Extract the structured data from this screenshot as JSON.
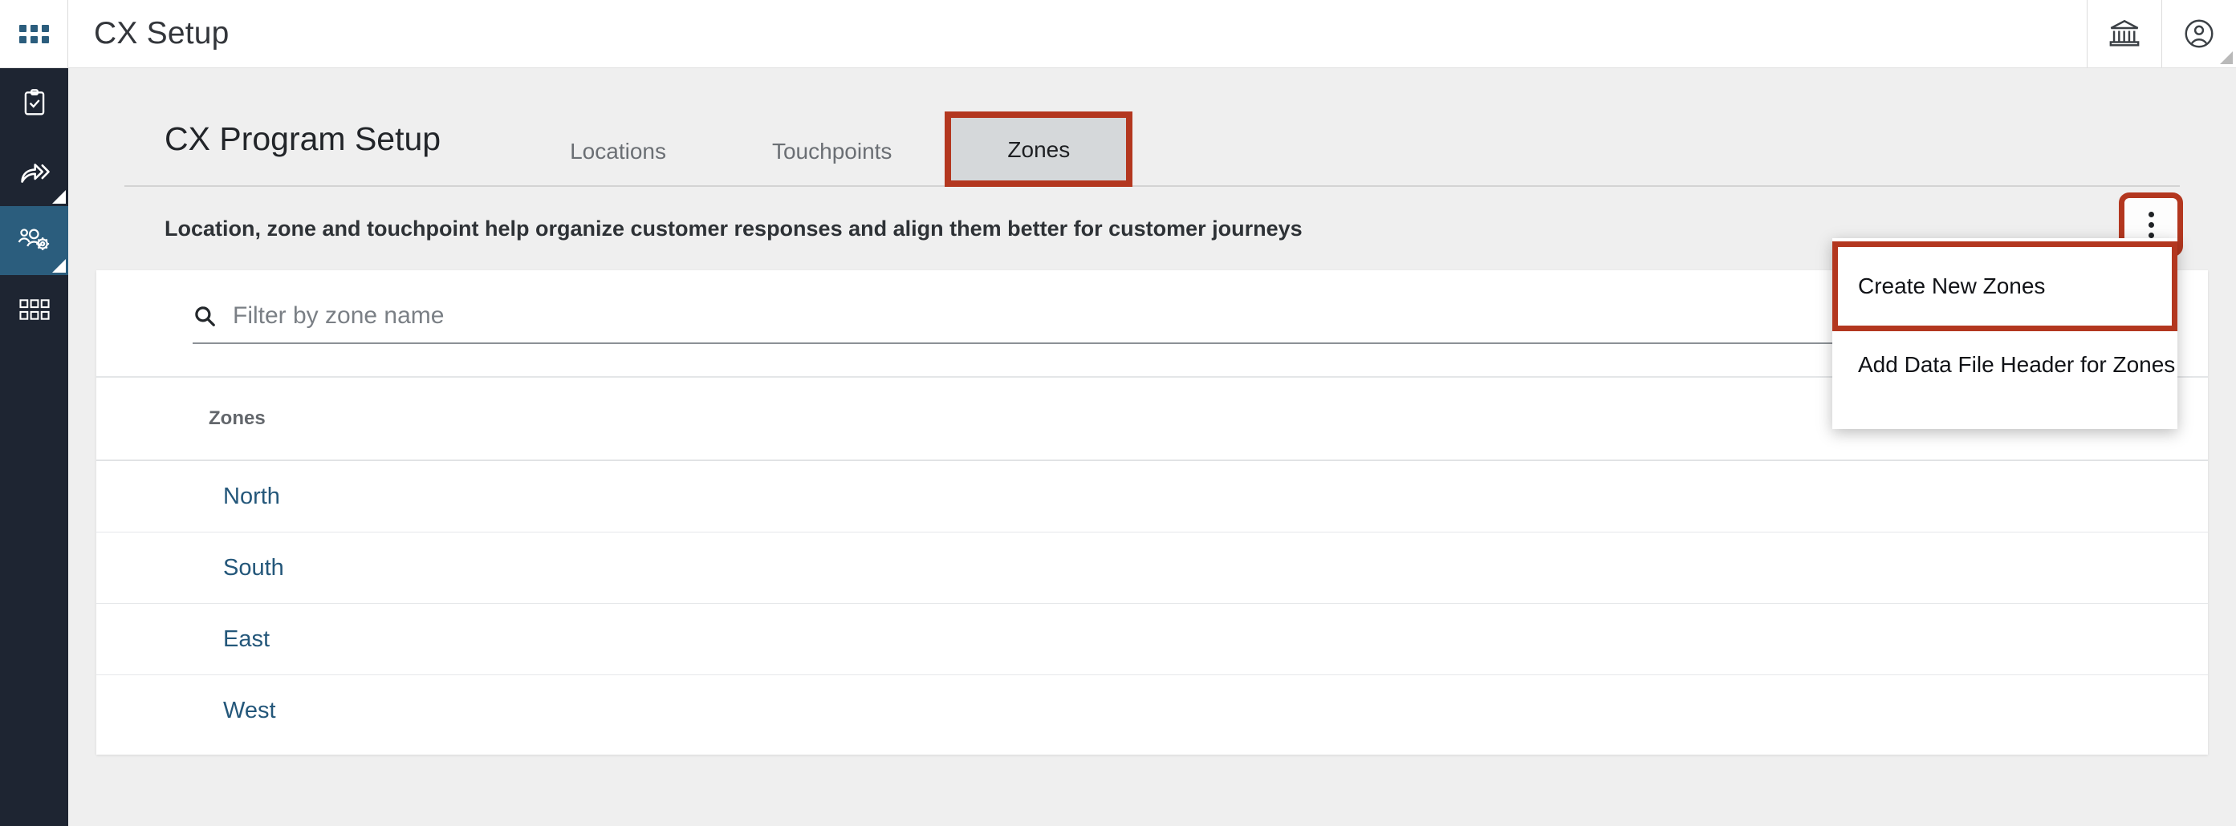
{
  "colors": {
    "sidebar_bg": "#1e2532",
    "sidebar_active": "#2b5d7d",
    "page_bg": "#efefef",
    "highlight_red": "#b3371f",
    "link_blue": "#24577a",
    "active_tab_bg": "#d5d8da"
  },
  "topbar": {
    "app_launcher_icon": "grid-dots-icon",
    "title": "CX Setup",
    "right_icons": [
      {
        "name": "bank-icon",
        "label": "Organization"
      },
      {
        "name": "user-account-icon",
        "label": "Account"
      }
    ]
  },
  "sidebar": {
    "items": [
      {
        "name": "sidebar-item-surveys",
        "icon": "clipboard-check-icon",
        "active": false,
        "has_expander": false
      },
      {
        "name": "sidebar-item-distribution",
        "icon": "share-arrow-icon",
        "active": false,
        "has_expander": true
      },
      {
        "name": "sidebar-item-cx-setup",
        "icon": "users-gear-icon",
        "active": true,
        "has_expander": true
      },
      {
        "name": "sidebar-item-apps",
        "icon": "grid-squares-icon",
        "active": false,
        "has_expander": false
      }
    ]
  },
  "main": {
    "page_title": "CX Program Setup",
    "tabs": [
      {
        "label": "Locations",
        "active": false
      },
      {
        "label": "Touchpoints",
        "active": false
      },
      {
        "label": "Zones",
        "active": true
      }
    ],
    "subtitle": "Location, zone and touchpoint help organize customer responses and align them better for customer journeys",
    "overflow_menu_icon": "kebab-vertical-icon",
    "dropdown": {
      "items": [
        {
          "label": "Create New Zones",
          "highlighted": true
        },
        {
          "label": "Add Data File Header for Zones",
          "highlighted": false
        }
      ]
    },
    "search": {
      "icon": "search-icon",
      "placeholder": "Filter by zone name",
      "value": ""
    },
    "table": {
      "columns": [
        "Zones"
      ],
      "rows": [
        {
          "zone": "North"
        },
        {
          "zone": "South"
        },
        {
          "zone": "East"
        },
        {
          "zone": "West"
        }
      ]
    }
  }
}
